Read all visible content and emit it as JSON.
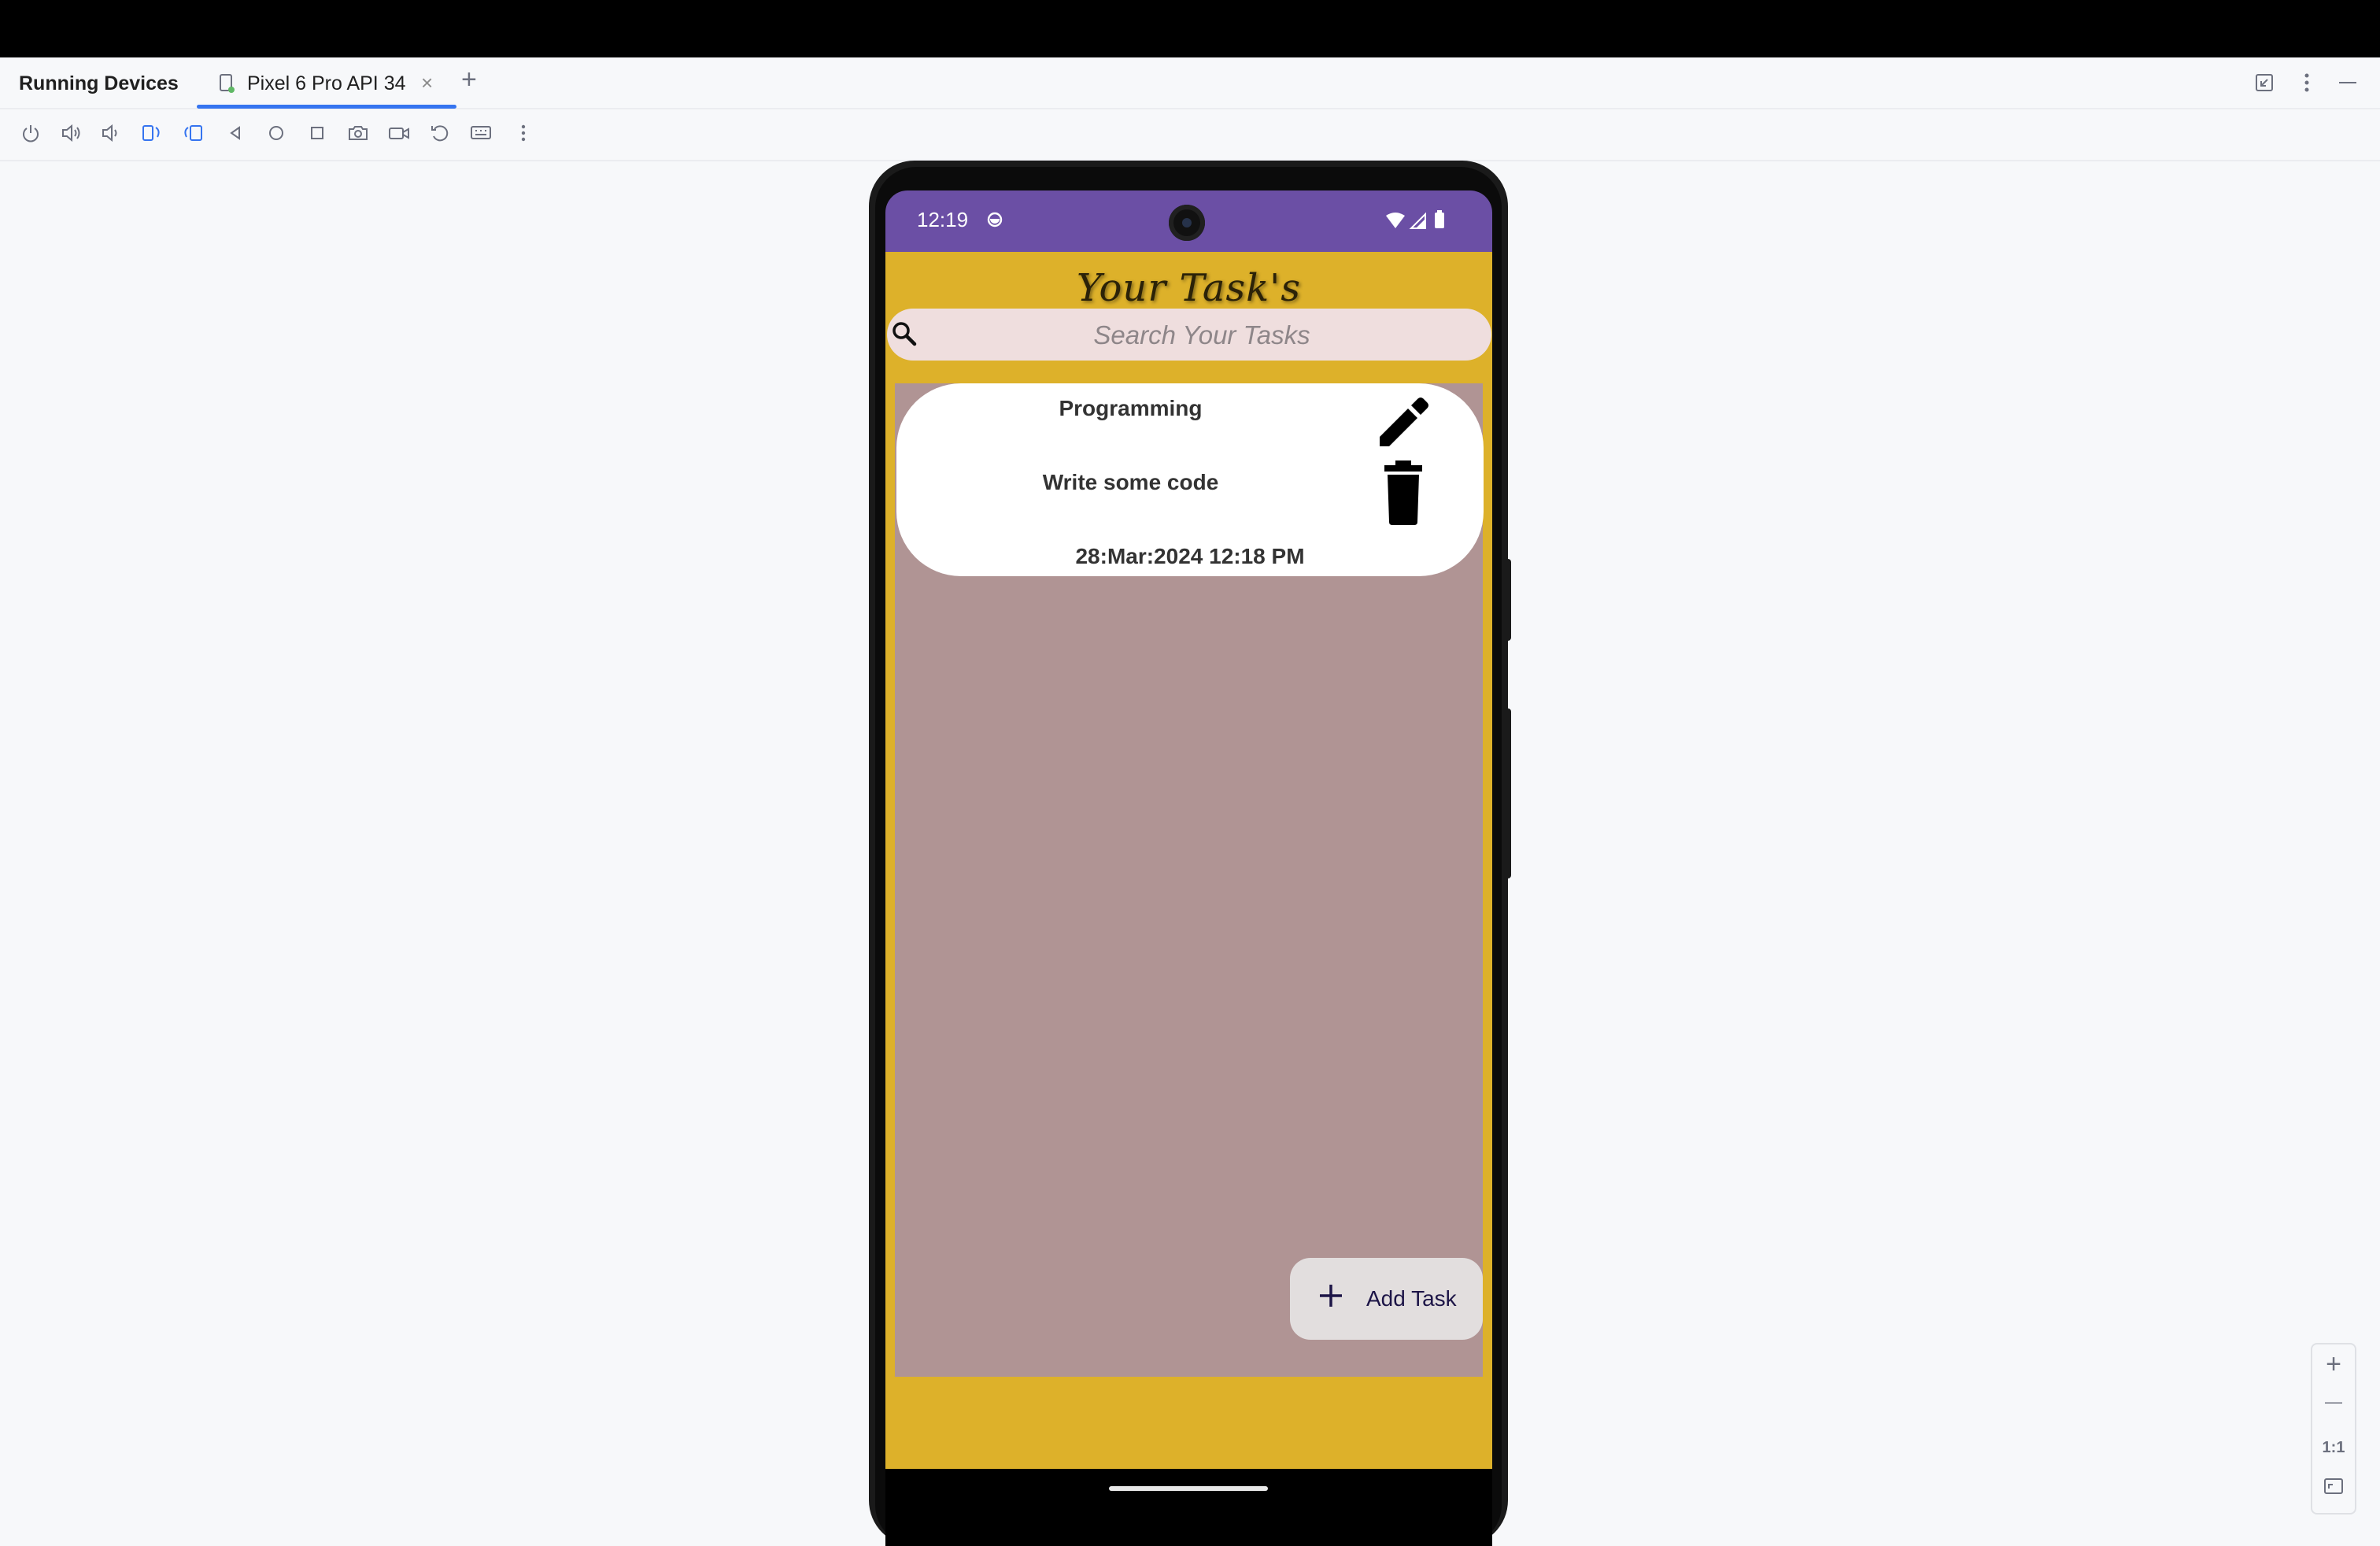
{
  "ide": {
    "panel_title": "Running Devices",
    "device_tab": "Pixel 6 Pro API 34",
    "tab_close": "×",
    "tab_add": "+"
  },
  "toolbar": {
    "icons": [
      "power-icon",
      "volume-up-icon",
      "volume-down-icon",
      "rotate-left-icon",
      "rotate-right-icon",
      "back-icon",
      "home-icon",
      "overview-icon",
      "screenshot-icon",
      "screen-record-icon",
      "reset-icon",
      "keyboard-icon",
      "more-icon"
    ]
  },
  "phone": {
    "status_bar": {
      "time": "12:19"
    },
    "app": {
      "title": "Your Task's",
      "search": {
        "value": "",
        "placeholder": "Search Your Tasks"
      },
      "tasks": [
        {
          "title": "Programming",
          "description": "Write some code",
          "date": "28:Mar:2024 12:18 PM"
        }
      ],
      "fab_label": "Add Task"
    }
  },
  "zoom_controls": {
    "zoom_in": "+",
    "zoom_out": "—",
    "actual_size": "1:1"
  },
  "colors": {
    "status_bar": "#6b4fa5",
    "app_background": "#ddb12a",
    "list_background": "#b09494",
    "search_background": "#efdede",
    "accent": "#3574f0"
  }
}
